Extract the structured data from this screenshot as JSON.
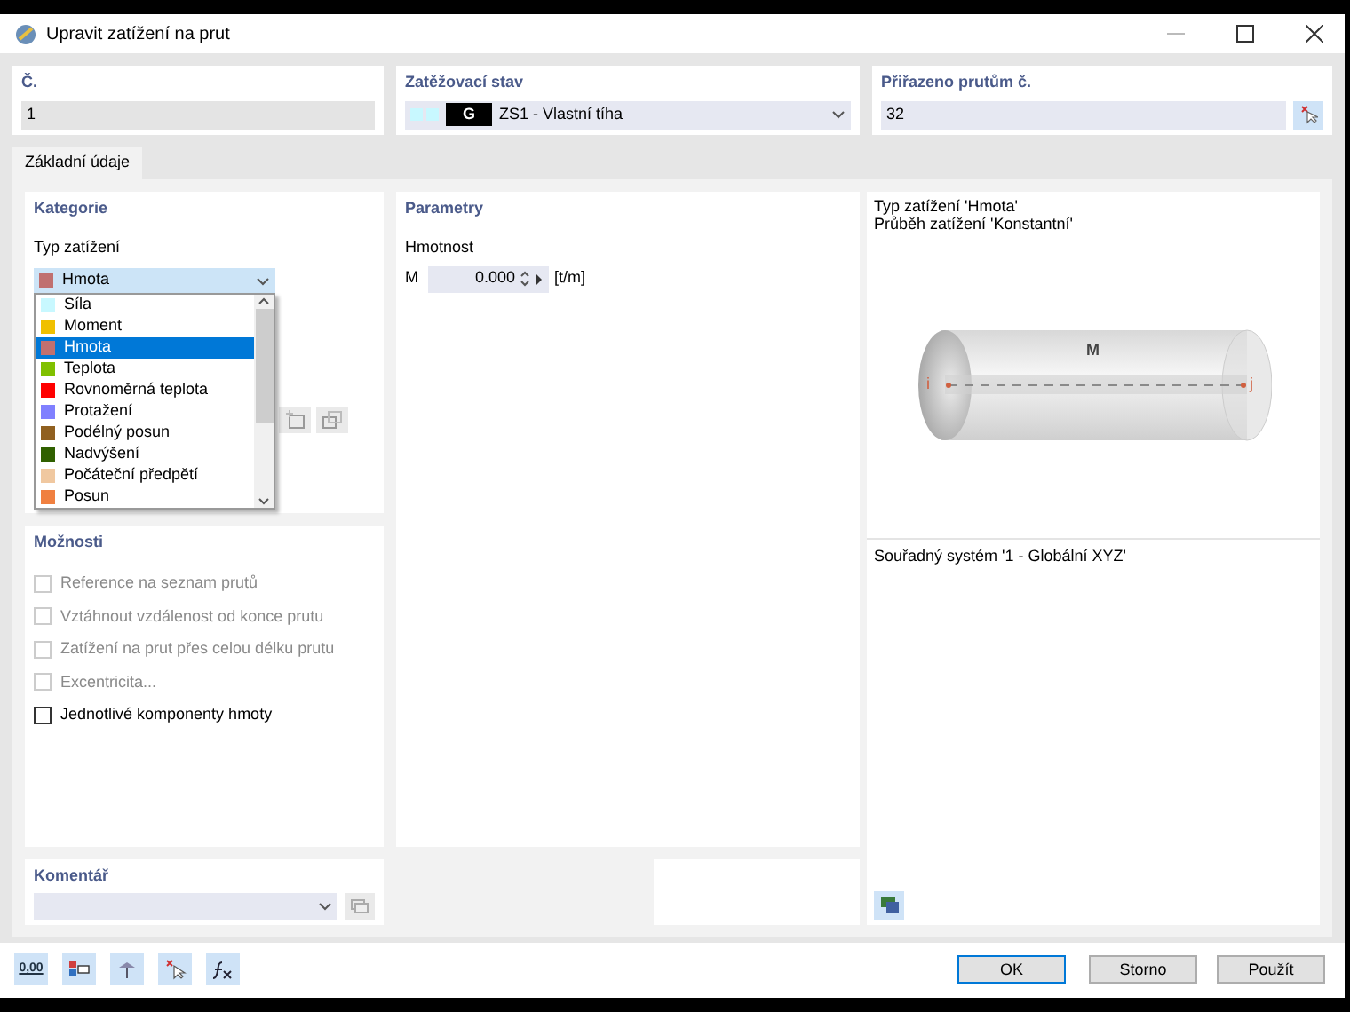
{
  "window": {
    "title": "Upravit zatížení na prut"
  },
  "number": {
    "label": "Č.",
    "value": "1"
  },
  "load_case": {
    "label": "Zatěžovací stav",
    "swatches": [
      {
        "color": "#c8f8ff"
      },
      {
        "color": "#c8f8ff"
      }
    ],
    "tag": "G",
    "value": "ZS1 - Vlastní tíha"
  },
  "assigned": {
    "label": "Přiřazeno prutům č.",
    "value": "32"
  },
  "tabs": [
    {
      "label": "Základní údaje",
      "selected": true
    }
  ],
  "category": {
    "title": "Kategorie",
    "type_label": "Typ zatížení",
    "combo": {
      "value": "Hmota",
      "color": "#c07070"
    },
    "options": [
      {
        "label": "Síla",
        "color": "#c8f8ff",
        "selected": false
      },
      {
        "label": "Moment",
        "color": "#f0c000",
        "selected": false
      },
      {
        "label": "Hmota",
        "color": "#c07070",
        "selected": true
      },
      {
        "label": "Teplota",
        "color": "#80c000",
        "selected": false
      },
      {
        "label": "Rovnoměrná teplota",
        "color": "#ff0000",
        "selected": false
      },
      {
        "label": "Protažení",
        "color": "#8080ff",
        "selected": false
      },
      {
        "label": "Podélný posun",
        "color": "#906020",
        "selected": false
      },
      {
        "label": "Nadvýšení",
        "color": "#306000",
        "selected": false
      },
      {
        "label": "Počáteční předpětí",
        "color": "#f0c8a0",
        "selected": false
      },
      {
        "label": "Posun",
        "color": "#f08040",
        "selected": false
      }
    ]
  },
  "parameters": {
    "title": "Parametry",
    "group": "Hmotnost",
    "rows": [
      {
        "symbol": "M",
        "value": "0.000",
        "unit": "[t/m]"
      }
    ]
  },
  "options": {
    "title": "Možnosti",
    "checkboxes": [
      {
        "label": "Reference na seznam prutů",
        "checked": false,
        "disabled": true
      },
      {
        "label": "Vztáhnout vzdálenost od konce prutu",
        "checked": false,
        "disabled": true
      },
      {
        "label": "Zatížení na prut přes celou délku prutu",
        "checked": false,
        "disabled": true
      },
      {
        "label": "Excentricita...",
        "checked": false,
        "disabled": true
      },
      {
        "label": "Jednotlivé komponenty hmoty",
        "checked": false,
        "disabled": false
      }
    ]
  },
  "preview": {
    "lines": [
      "Typ zatížení 'Hmota'",
      "Průběh zatížení 'Konstantní'"
    ],
    "symbol": "M",
    "start": "i",
    "end": "j",
    "coords": "Souřadný systém '1 - Globální XYZ'"
  },
  "comment": {
    "title": "Komentář"
  },
  "footer": {
    "units_icon_text": "0,00",
    "buttons": [
      {
        "label": "OK",
        "default": true
      },
      {
        "label": "Storno",
        "default": false
      },
      {
        "label": "Použít",
        "default": false
      }
    ]
  }
}
